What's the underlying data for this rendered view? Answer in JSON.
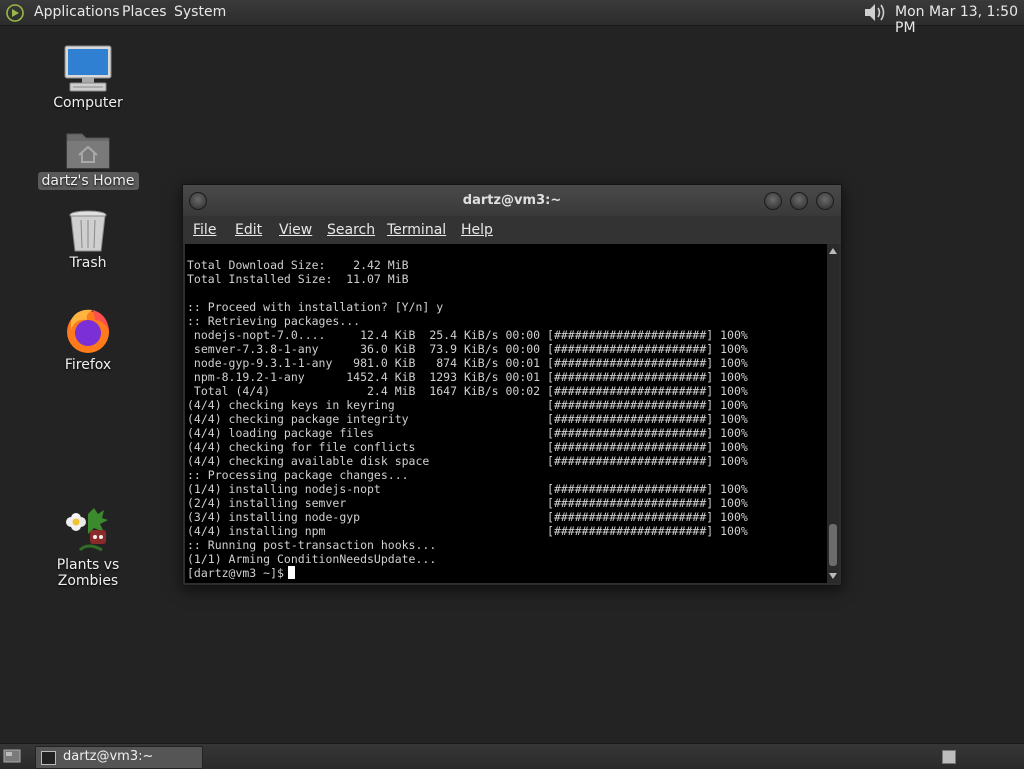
{
  "top_panel": {
    "menus": [
      "Applications",
      "Places",
      "System"
    ],
    "clock": "Mon Mar 13,  1:50 PM"
  },
  "desktop": {
    "icons": [
      {
        "label": "Computer",
        "icon": "computer-icon"
      },
      {
        "label": "dartz's Home",
        "icon": "home-folder-icon",
        "selected": true
      },
      {
        "label": "Trash",
        "icon": "trash-icon"
      },
      {
        "label": "Firefox",
        "icon": "firefox-icon"
      },
      {
        "label": "Plants vs Zombies",
        "icon": "plants-vs-zombies-icon"
      }
    ]
  },
  "terminal": {
    "title": "dartz@vm3:~",
    "menu": [
      "File",
      "Edit",
      "View",
      "Search",
      "Terminal",
      "Help"
    ],
    "lines": [
      "Total Download Size:    2.42 MiB",
      "Total Installed Size:  11.07 MiB",
      "",
      ":: Proceed with installation? [Y/n] y",
      ":: Retrieving packages...",
      " nodejs-nopt-7.0....     12.4 KiB  25.4 KiB/s 00:00 [######################] 100%",
      " semver-7.3.8-1-any      36.0 KiB  73.9 KiB/s 00:00 [######################] 100%",
      " node-gyp-9.3.1-1-any   981.0 KiB   874 KiB/s 00:01 [######################] 100%",
      " npm-8.19.2-1-any      1452.4 KiB  1293 KiB/s 00:01 [######################] 100%",
      " Total (4/4)              2.4 MiB  1647 KiB/s 00:02 [######################] 100%",
      "(4/4) checking keys in keyring                      [######################] 100%",
      "(4/4) checking package integrity                    [######################] 100%",
      "(4/4) loading package files                         [######################] 100%",
      "(4/4) checking for file conflicts                   [######################] 100%",
      "(4/4) checking available disk space                 [######################] 100%",
      ":: Processing package changes...",
      "(1/4) installing nodejs-nopt                        [######################] 100%",
      "(2/4) installing semver                             [######################] 100%",
      "(3/4) installing node-gyp                           [######################] 100%",
      "(4/4) installing npm                                [######################] 100%",
      ":: Running post-transaction hooks...",
      "(1/1) Arming ConditionNeedsUpdate..."
    ],
    "prompt": "[dartz@vm3 ~]$"
  },
  "taskbar": {
    "tasks": [
      {
        "label": "dartz@vm3:~"
      }
    ]
  }
}
